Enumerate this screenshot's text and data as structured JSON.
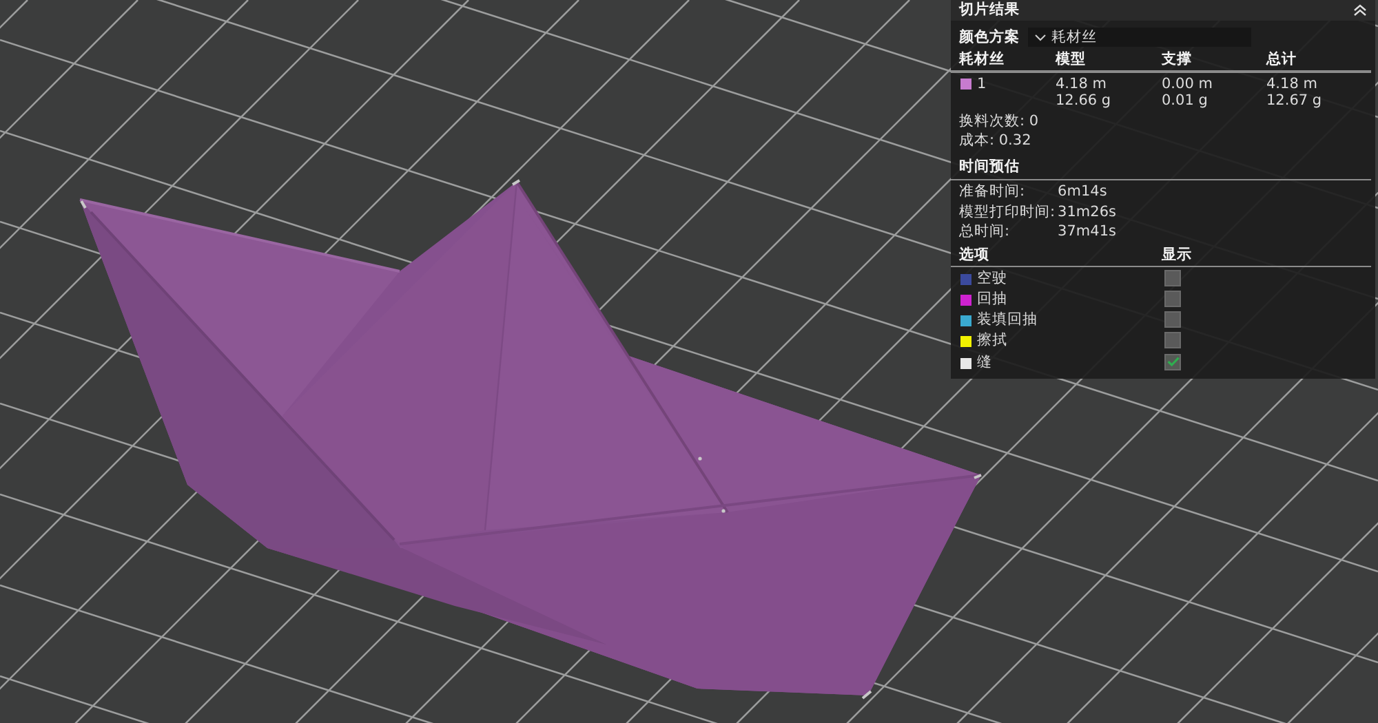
{
  "panel": {
    "title": "切片结果",
    "expanded": true
  },
  "color_scheme": {
    "label": "颜色方案",
    "value": "耗材丝"
  },
  "filament_table": {
    "columns": [
      "耗材丝",
      "模型",
      "支撑",
      "总计"
    ],
    "rows": [
      {
        "name": "1",
        "color": "#c77bcf",
        "model": [
          "4.18 m",
          "12.66 g"
        ],
        "support": [
          "0.00 m",
          "0.01 g"
        ],
        "total": [
          "4.18 m",
          "12.67 g"
        ]
      }
    ]
  },
  "summary": [
    "换料次数: 0",
    "成本: 0.32"
  ],
  "time_estimate": {
    "title": "时间预估",
    "rows": [
      {
        "label": "准备时间:",
        "value": "6m14s"
      },
      {
        "label": "模型打印时间:",
        "value": "31m26s"
      },
      {
        "label": "总时间:",
        "value": "37m41s"
      }
    ]
  },
  "options": {
    "columns": [
      "选项",
      "显示"
    ],
    "items": [
      {
        "label": "空驶",
        "color": "#3b4a9e",
        "checked": false
      },
      {
        "label": "回抽",
        "color": "#cf22d0",
        "checked": false
      },
      {
        "label": "装填回抽",
        "color": "#3aaad0",
        "checked": false
      },
      {
        "label": "擦拭",
        "color": "#f2f200",
        "checked": false
      },
      {
        "label": "缝",
        "color": "#e8e8e8",
        "checked": true
      }
    ]
  }
}
